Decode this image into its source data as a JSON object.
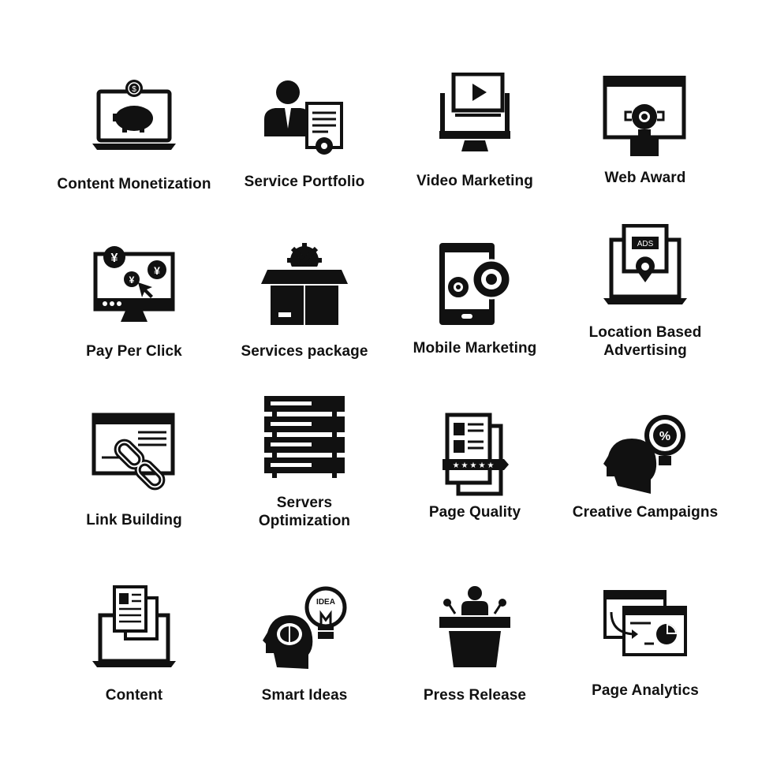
{
  "colors": {
    "icon": "#111111",
    "background": "#ffffff"
  },
  "icons": [
    {
      "label": "Content Monetization",
      "icon": "laptop-piggy-bank-icon"
    },
    {
      "label": "Service Portfolio",
      "icon": "businessman-document-gear-icon"
    },
    {
      "label": "Video Marketing",
      "icon": "monitor-video-play-icon"
    },
    {
      "label": "Web Award",
      "icon": "browser-trophy-icon"
    },
    {
      "label": "Pay Per Click",
      "icon": "monitor-yen-cursor-icon"
    },
    {
      "label": "Services package",
      "icon": "box-gear-icon"
    },
    {
      "label": "Mobile Marketing",
      "icon": "phone-gears-icon"
    },
    {
      "label": "Location Based Advertising",
      "line1": "Location Based",
      "line2": "Advertising",
      "icon": "laptop-ads-pin-icon",
      "ads_text": "ADS"
    },
    {
      "label": "Link Building",
      "icon": "browser-chain-link-icon"
    },
    {
      "label": "Servers Optimization",
      "line1": "Servers",
      "line2": "Optimization",
      "icon": "server-rack-icon"
    },
    {
      "label": "Page Quality",
      "icon": "document-stars-icon"
    },
    {
      "label": "Creative Campaigns",
      "icon": "head-bulb-percent-icon"
    },
    {
      "label": "Content",
      "icon": "laptop-documents-icon"
    },
    {
      "label": "Smart Ideas",
      "icon": "brain-idea-bulb-icon",
      "bulb_text": "IDEA"
    },
    {
      "label": "Press Release",
      "icon": "speaker-podium-icon"
    },
    {
      "label": "Page Analytics",
      "icon": "browser-pie-chart-icon"
    }
  ],
  "yen_symbol": "¥",
  "dollar_symbol": "$",
  "percent_symbol": "%"
}
